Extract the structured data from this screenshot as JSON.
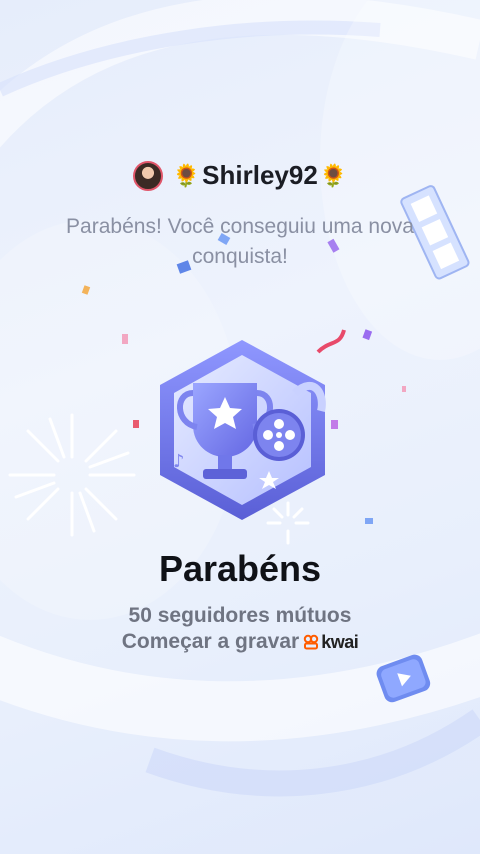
{
  "header": {
    "username": "Shirley92",
    "emoji_left": "🌻",
    "emoji_right": "🌻"
  },
  "subtitle": "Parabéns! Você conseguiu uma nova conquista!",
  "achievement": {
    "title": "Parabéns",
    "description": "50 seguidores mútuos",
    "record_label": "Começar a gravar",
    "brand": "kwai"
  },
  "colors": {
    "brand": "#ff5c00",
    "badge_main": "#6f72e6",
    "badge_light": "#aeb8ff",
    "background": "#e8effc"
  },
  "icons": [
    "avatar",
    "sunflower-icon",
    "trophy-icon",
    "film-reel-icon",
    "kwai-logo-icon",
    "play-icon"
  ]
}
